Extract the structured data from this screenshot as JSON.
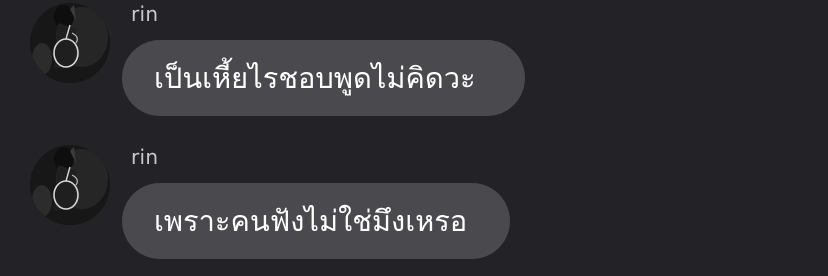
{
  "messages": [
    {
      "sender": "rin",
      "text": "เป็นเหี้ยไรชอบพูดไม่คิดวะ"
    },
    {
      "sender": "rin",
      "text": "เพราะคนฟังไม่ใช่มึงเหรอ"
    }
  ],
  "colors": {
    "background": "#232327",
    "bubble": "#4a4a4e",
    "bubble_text": "#ffffff",
    "sender_name": "#c9c9cc"
  },
  "icons": {
    "avatar": "user-avatar-photo"
  }
}
